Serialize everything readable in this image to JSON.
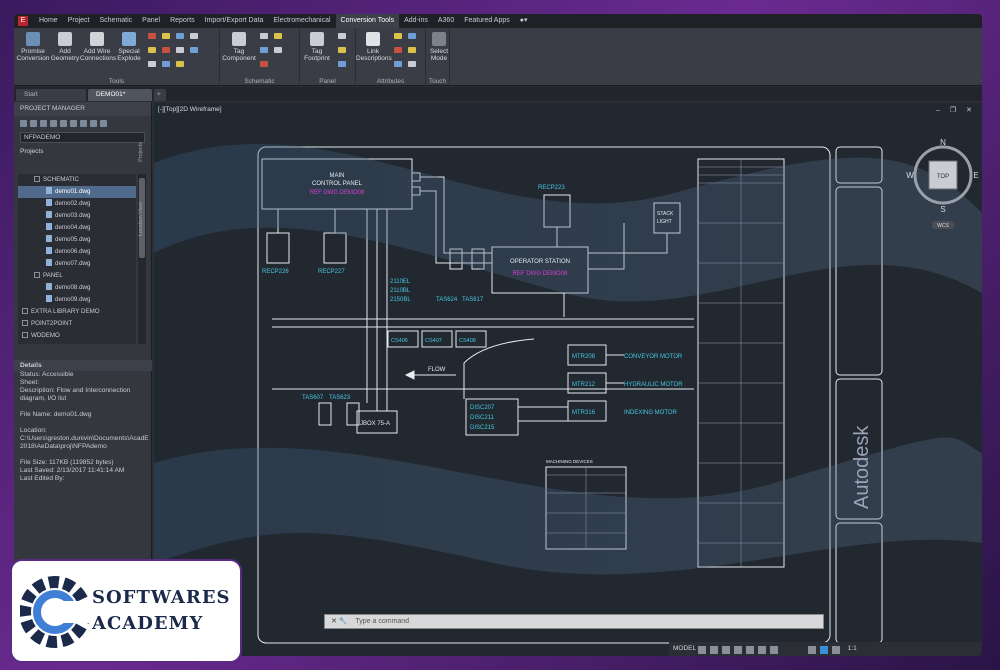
{
  "menubar": {
    "items": [
      "Home",
      "Project",
      "Schematic",
      "Panel",
      "Reports",
      "Import/Export Data",
      "Electromechanical",
      "Conversion Tools",
      "Add-ins",
      "A360",
      "Featured Apps"
    ],
    "active": "Conversion Tools"
  },
  "ribbon": {
    "tools_buttons": [
      "Promise Conversion",
      "Add Geometry",
      "Add Wire Connections",
      "Special Explode"
    ],
    "tools_label": "Tools",
    "schematic_button": "Tag Component",
    "schematic_label": "Schematic",
    "panel_button": "Tag Footprint",
    "panel_label": "Panel",
    "attributes_button": "Link Descriptions",
    "attributes_label": "Attributes",
    "touch_button": "Select Mode",
    "touch_label": "Touch"
  },
  "file_tabs": [
    "Start",
    "DEMO01*"
  ],
  "active_tab": "DEMO01*",
  "project_manager": {
    "title": "PROJECT MANAGER",
    "selector": "NFPADEMO",
    "projects_label": "Projects",
    "tree": [
      {
        "label": "SCHEMATIC",
        "indent": 1,
        "type": "folder"
      },
      {
        "label": "demo01.dwg",
        "indent": 2,
        "type": "file",
        "selected": true
      },
      {
        "label": "demo02.dwg",
        "indent": 2,
        "type": "file"
      },
      {
        "label": "demo03.dwg",
        "indent": 2,
        "type": "file"
      },
      {
        "label": "demo04.dwg",
        "indent": 2,
        "type": "file"
      },
      {
        "label": "demo05.dwg",
        "indent": 2,
        "type": "file"
      },
      {
        "label": "demo06.dwg",
        "indent": 2,
        "type": "file"
      },
      {
        "label": "demo07.dwg",
        "indent": 2,
        "type": "file"
      },
      {
        "label": "PANEL",
        "indent": 1,
        "type": "folder"
      },
      {
        "label": "demo08.dwg",
        "indent": 2,
        "type": "file"
      },
      {
        "label": "demo09.dwg",
        "indent": 2,
        "type": "file"
      },
      {
        "label": "EXTRA LIBRARY DEMO",
        "indent": 0,
        "type": "project"
      },
      {
        "label": "POINT2POINT",
        "indent": 0,
        "type": "project"
      },
      {
        "label": "WDDEMO",
        "indent": 0,
        "type": "project"
      }
    ],
    "side_tabs": [
      "Projects",
      "Location View"
    ]
  },
  "details": {
    "header": "Details",
    "lines": [
      "Status: Accessible",
      "Sheet:",
      "Description: Flow and Interconnection diagram, I/O list",
      "",
      "File Name: demo01.dwg",
      "",
      "Location: C:\\Users\\greston.dunivin\\Documents\\AcadE 2018\\AeData\\proj\\NFPAdemo",
      "",
      "File Size: 117KB (119852 bytes)",
      "Last Saved: 2/13/2017 11:41:14 AM",
      "Last Edited By:"
    ]
  },
  "viewport": {
    "label": "[-][Top][2D Wireframe]",
    "viewcube": {
      "n": "N",
      "s": "S",
      "e": "E",
      "w": "W",
      "face": "TOP",
      "wcs": "WCS"
    }
  },
  "drawing": {
    "main_panel": [
      "MAIN",
      "CONTROL PANEL",
      "REF DWG DEMO08"
    ],
    "recp_left": "RECP226",
    "recp_mid": "RECP227",
    "recp_right": "RECP223",
    "stack_light": [
      "STACK",
      "LIGHT"
    ],
    "operator_station": [
      "OPERATOR STATION",
      "REF DWG DEMO08"
    ],
    "pb_labels": [
      "2110EL",
      "2110BL",
      "2150BL"
    ],
    "tas_top": [
      "TAS624",
      "TAS617"
    ],
    "cs_boxes": [
      "CS406",
      "CS407",
      "CS408"
    ],
    "flow": "FLOW",
    "tas_bottom": [
      "TAS607",
      "TAS623"
    ],
    "jbox": "JBOX 75-A",
    "disc": [
      "DISC207",
      "DISC211",
      "DISC215"
    ],
    "motors": [
      {
        "tag": "MTR208",
        "name": "CONVEYOR MOTOR"
      },
      {
        "tag": "MTR212",
        "name": "HYDRAULIC MOTOR"
      },
      {
        "tag": "MTR316",
        "name": "INDEXING MOTOR"
      }
    ],
    "machining_title": "MACHINING DEVICES",
    "brand": "Autodesk"
  },
  "command_line": {
    "placeholder": "Type a command"
  },
  "statusbar": {
    "model": "MODEL",
    "scale": "1:1"
  },
  "logo": {
    "line1": "SOFTWARES",
    "line2": "ACADEMY"
  },
  "colors": {
    "magenta": "#d43fd1",
    "cyan": "#47c7e0",
    "white": "#e8eaee",
    "accent": "#506a8c"
  }
}
